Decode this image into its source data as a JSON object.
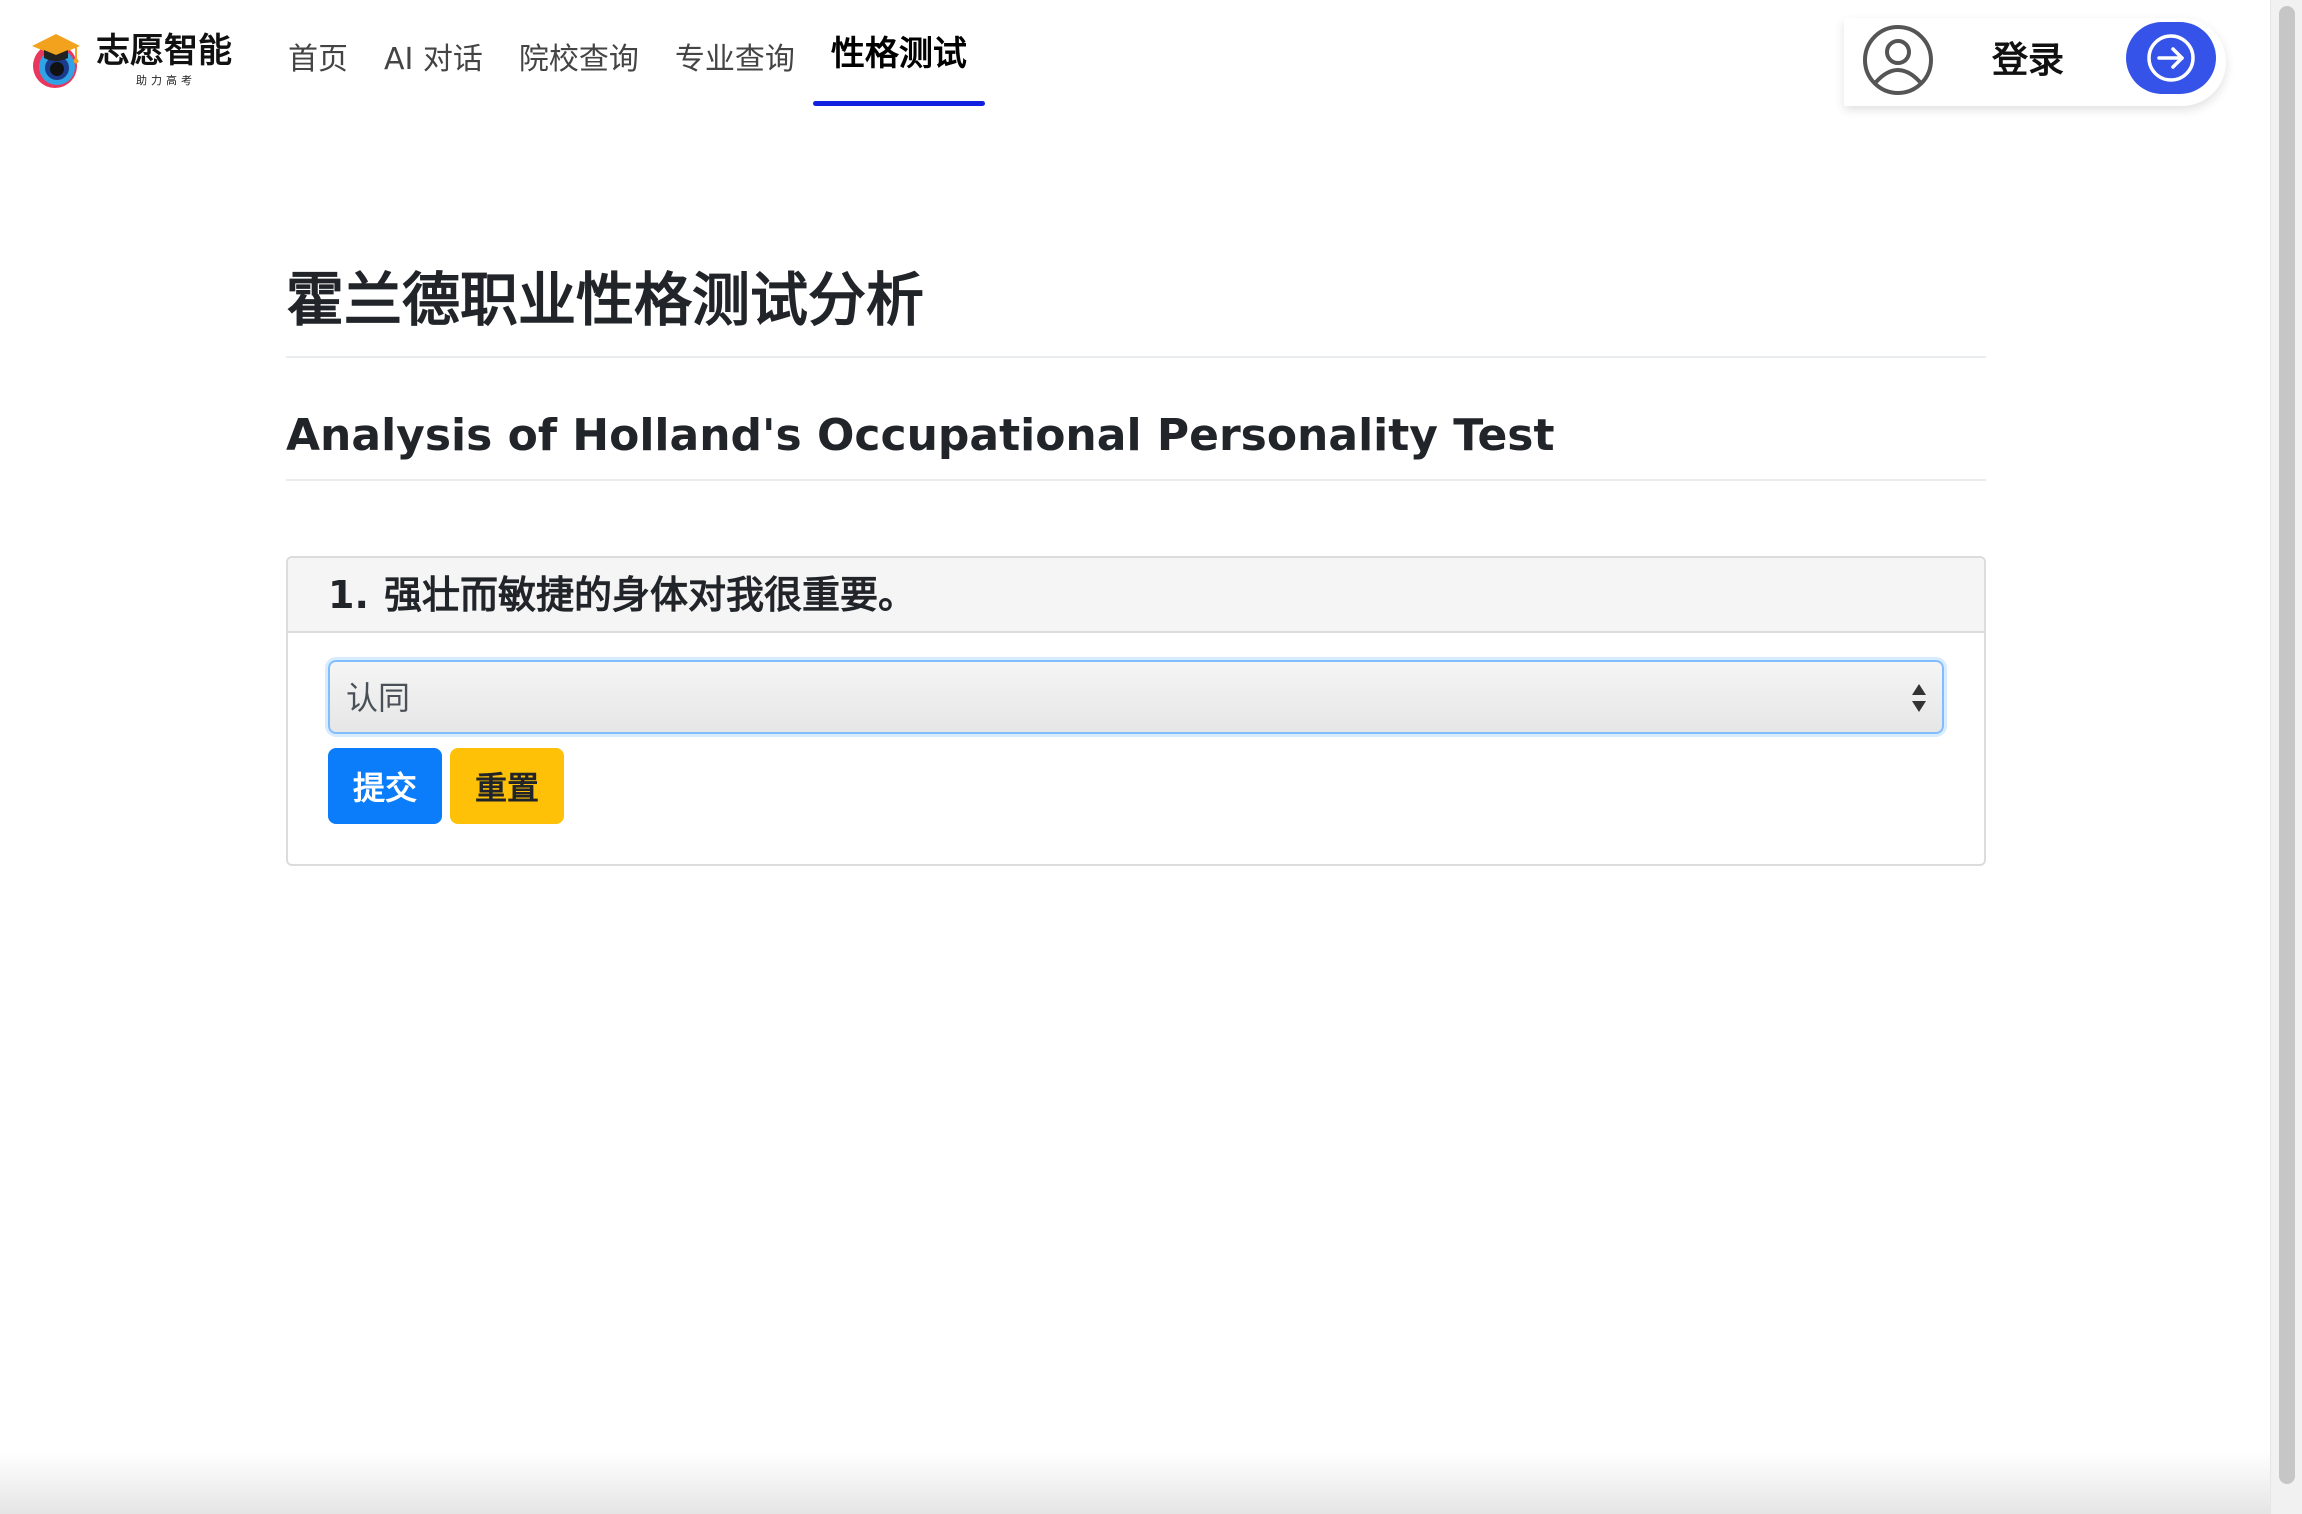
{
  "header": {
    "logo": {
      "title": "志愿智能",
      "subtitle": "助力高考"
    },
    "nav": [
      {
        "label": "首页",
        "active": false
      },
      {
        "label": "AI 对话",
        "active": false
      },
      {
        "label": "院校查询",
        "active": false
      },
      {
        "label": "专业查询",
        "active": false
      },
      {
        "label": "性格测试",
        "active": true
      }
    ],
    "user": {
      "login_label": "登录",
      "avatar_icon": "user-circle-icon",
      "login_icon": "arrow-right-circle-icon"
    }
  },
  "main": {
    "title": "霍兰德职业性格测试分析",
    "subtitle": "Analysis of Holland's Occupational Personality Test",
    "question": {
      "number": "1.",
      "text": "强壮而敏捷的身体对我很重要。",
      "selected_answer": "认同"
    },
    "buttons": {
      "submit": "提交",
      "reset": "重置"
    }
  },
  "colors": {
    "nav_active_underline": "#1020e0",
    "login_button": "#3553e8",
    "submit_button": "#0b7dfb",
    "reset_button": "#ffc107",
    "select_focus_border": "#80bdff"
  }
}
